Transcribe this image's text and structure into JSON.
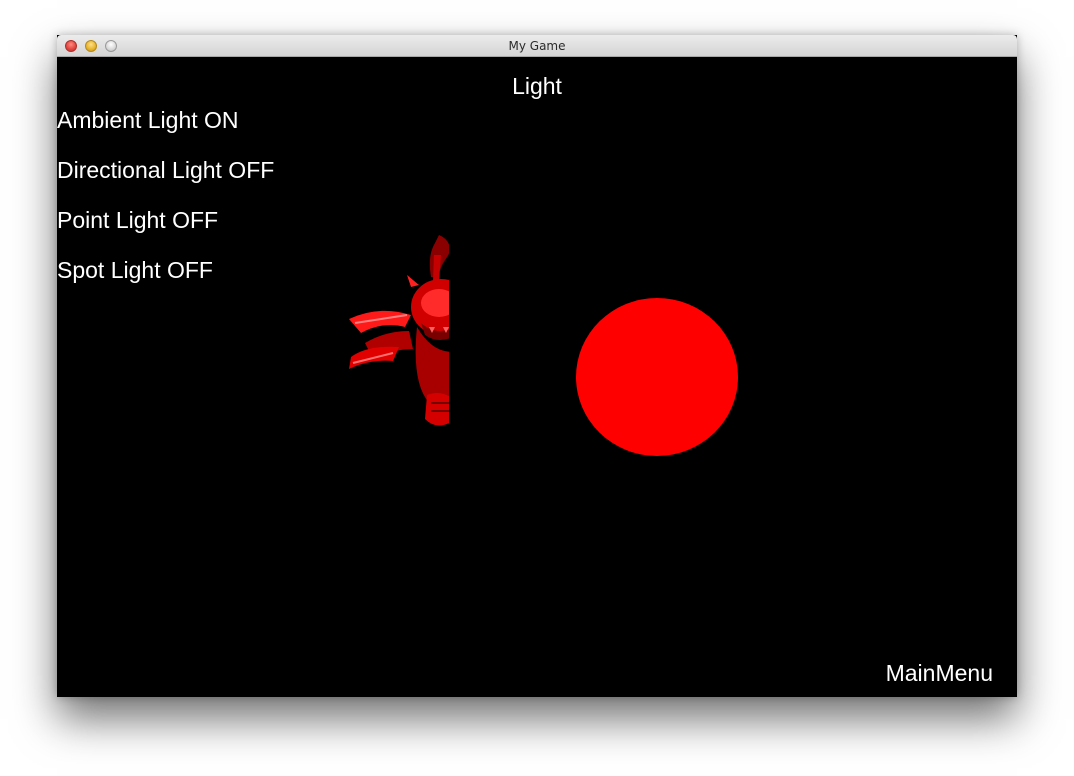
{
  "window": {
    "title": "My Game"
  },
  "scene": {
    "title": "Light",
    "menu_items": [
      "Ambient Light ON",
      "Directional Light OFF",
      "Point Light OFF",
      "Spot Light OFF"
    ],
    "main_menu_label": "MainMenu"
  },
  "colors": {
    "background": "#000000",
    "text": "#ffffff",
    "sphere": "#ff0000",
    "character": "#e00000"
  },
  "icons": {
    "close": "close-icon",
    "minimize": "minimize-icon",
    "zoom": "zoom-icon"
  }
}
